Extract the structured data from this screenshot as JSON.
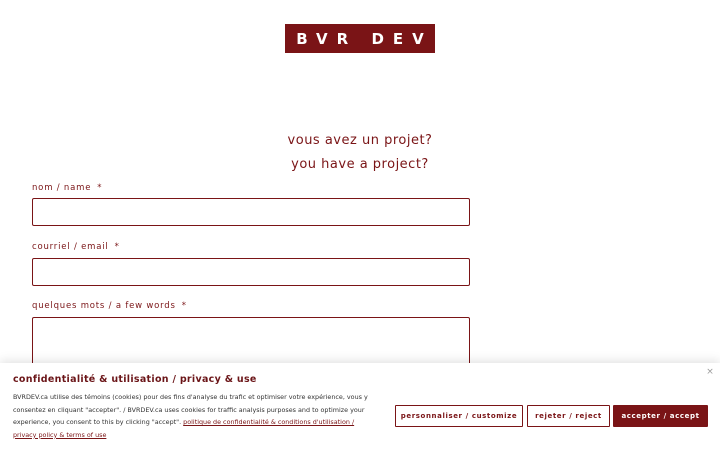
{
  "logo": {
    "text": "BVR DEV"
  },
  "form": {
    "heading_fr": "vous avez un projet?",
    "heading_en": "you have a project?",
    "fields": [
      {
        "label": "nom / name",
        "required": "*",
        "value": ""
      },
      {
        "label": "courriel / email",
        "required": "*",
        "value": ""
      },
      {
        "label": "quelques mots / a few words",
        "required": "*",
        "value": ""
      }
    ]
  },
  "cookie_banner": {
    "title": "confidentialité & utilisation / privacy & use",
    "close_glyph": "×",
    "text": "BVRDEV.ca utilise des témoins (cookies) pour des fins d'analyse du trafic et optimiser votre expérience, vous y consentez en cliquant \"accepter\". / BVRDEV.ca uses cookies for traffic analysis purposes and to optimize your experience, you consent to this by clicking \"accept\". ",
    "policy_link": "politique de confidentialité & conditions d'utilisation / privacy policy & terms of use",
    "buttons": {
      "customize": "personnaliser / customize",
      "reject": "rejeter / reject",
      "accept": "accepter / accept"
    }
  },
  "colors": {
    "brand": "#7a1416"
  }
}
